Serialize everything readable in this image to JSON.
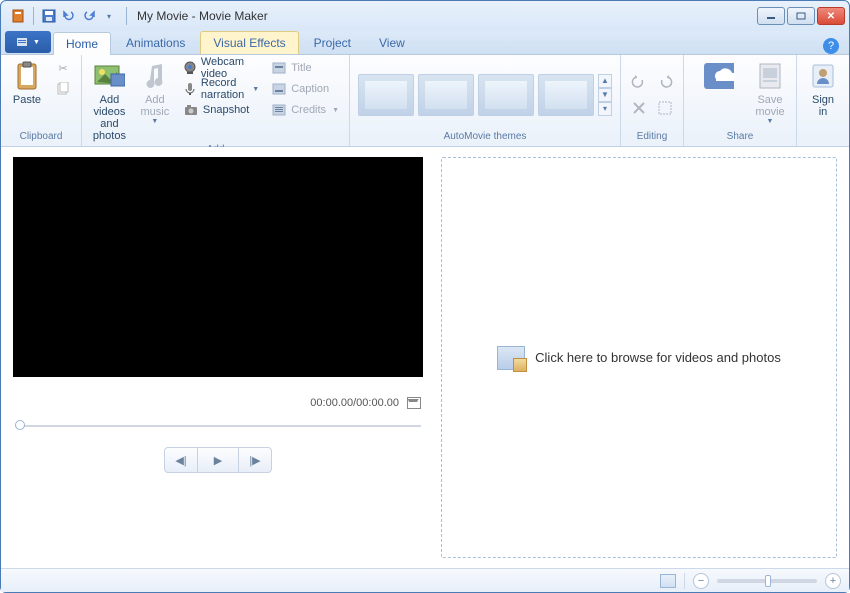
{
  "window": {
    "title": "My Movie - Movie Maker"
  },
  "tabs": {
    "home": "Home",
    "animations": "Animations",
    "visual_effects": "Visual Effects",
    "project": "Project",
    "view": "View"
  },
  "ribbon": {
    "clipboard": {
      "label": "Clipboard",
      "paste": "Paste"
    },
    "add": {
      "label": "Add",
      "add_videos": "Add videos\nand photos",
      "add_music": "Add\nmusic",
      "webcam": "Webcam video",
      "record": "Record narration",
      "snapshot": "Snapshot",
      "title": "Title",
      "caption": "Caption",
      "credits": "Credits"
    },
    "themes": {
      "label": "AutoMovie themes"
    },
    "editing": {
      "label": "Editing"
    },
    "share": {
      "label": "Share",
      "save_movie": "Save\nmovie",
      "sign_in": "Sign\nin"
    }
  },
  "preview": {
    "time": "00:00.00/00:00.00"
  },
  "drop": {
    "text": "Click here to browse for videos and photos"
  }
}
